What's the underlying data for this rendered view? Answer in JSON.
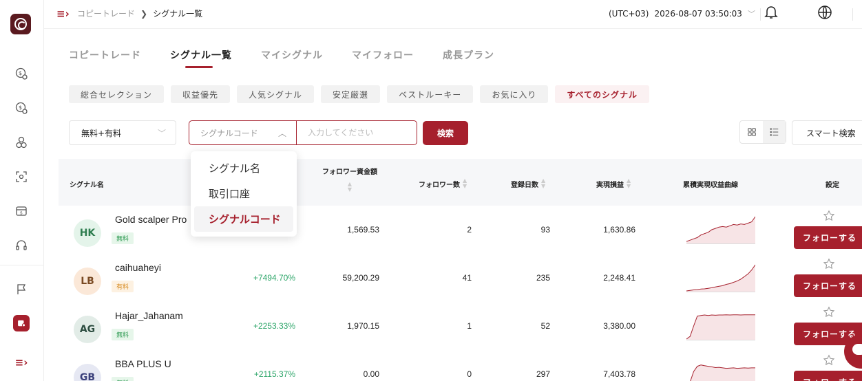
{
  "header": {
    "breadcrumb": [
      "コピートレード",
      "シグナル一覧"
    ],
    "breadcrumb_sep": "❯",
    "timezone": "(UTC+03)",
    "datetime": "2026-08-07 03:50:03"
  },
  "tabs": [
    "コピートレード",
    "シグナル一覧",
    "マイシグナル",
    "マイフォロー",
    "成長プラン"
  ],
  "active_tab": "シグナル一覧",
  "chips": [
    "総合セレクション",
    "収益優先",
    "人気シグナル",
    "安定厳選",
    "ベストルーキー",
    "お気に入り",
    "すべてのシグナル"
  ],
  "active_chip": "すべてのシグナル",
  "filters": {
    "price_select": "無料+有料",
    "search_type": "シグナルコード",
    "search_placeholder": "入力してください",
    "search_button": "検索",
    "smart_search": "スマート検索"
  },
  "dropdown": {
    "options": [
      "シグナル名",
      "取引口座",
      "シグナルコード"
    ],
    "selected": "シグナルコード"
  },
  "table": {
    "headers": {
      "name": "シグナル名",
      "follower_funds": "フォロワー資金額",
      "followers": "フォロワー数",
      "days": "登録日数",
      "profit": "実現損益",
      "curve": "累積実現収益曲線",
      "settings": "設定"
    },
    "rows": [
      {
        "initials": "HK",
        "name": "Gold scalper Pro",
        "badge": "無料",
        "badge_type": "free",
        "return": "",
        "funds": "1,569.53",
        "followers": "2",
        "days": "93",
        "profit": "1,630.86",
        "avatar_bg": "#e4f4ea",
        "avatar_fg": "#2e7d4f",
        "curve": [
          0.05,
          0.1,
          0.15,
          0.2,
          0.3,
          0.35,
          0.4,
          0.5,
          0.55,
          0.6,
          0.62,
          0.6,
          0.65,
          0.7,
          0.68,
          0.72,
          0.7,
          0.75,
          0.8,
          1.0
        ],
        "follow_label": "フォローする"
      },
      {
        "initials": "LB",
        "name": "caihuaheyi",
        "badge": "有料",
        "badge_type": "paid",
        "return": "+7494.70%",
        "funds": "59,200.29",
        "followers": "41",
        "days": "235",
        "profit": "2,248.41",
        "avatar_bg": "#fbe8d8",
        "avatar_fg": "#7a4a23",
        "curve": [
          0.0,
          0.02,
          0.04,
          0.05,
          0.07,
          0.08,
          0.1,
          0.12,
          0.15,
          0.18,
          0.2,
          0.25,
          0.28,
          0.33,
          0.38,
          0.45,
          0.55,
          0.65,
          0.8,
          1.0
        ],
        "follow_label": "フォローする"
      },
      {
        "initials": "AG",
        "name": "Hajar_Jahanam",
        "badge": "無料",
        "badge_type": "free",
        "return": "+2253.33%",
        "funds": "1,970.15",
        "followers": "1",
        "days": "52",
        "profit": "3,380.00",
        "avatar_bg": "#e2ece7",
        "avatar_fg": "#2c4d40",
        "curve": [
          0.0,
          0.1,
          0.5,
          0.88,
          0.9,
          0.92,
          0.9,
          0.92,
          0.91,
          0.92,
          0.92,
          0.93,
          0.92,
          0.93,
          0.93,
          0.92,
          0.93,
          0.93,
          0.93,
          0.93
        ],
        "follow_label": "フォローする"
      },
      {
        "initials": "GB",
        "name": "BBA PLUS U",
        "badge": "無料",
        "badge_type": "free",
        "return": "+2115.37%",
        "funds": "0.00",
        "followers": "0",
        "days": "297",
        "profit": "7,403.78",
        "avatar_bg": "#e6e8f3",
        "avatar_fg": "#3a3f7a",
        "curve": [
          0.0,
          0.2,
          0.6,
          0.8,
          0.85,
          0.82,
          0.8,
          0.78,
          0.75,
          0.76,
          0.74,
          0.72,
          0.73,
          0.74,
          0.72,
          0.73,
          0.74,
          0.73,
          0.74,
          0.74
        ],
        "follow_label": "フォローする"
      }
    ]
  },
  "colors": {
    "brand": "#a6202d",
    "return_green": "#2ea66a"
  },
  "icons": [
    "bell-icon",
    "globe-icon",
    "menu-toggle-icon",
    "grid-view-icon",
    "list-view-icon",
    "star-icon"
  ]
}
